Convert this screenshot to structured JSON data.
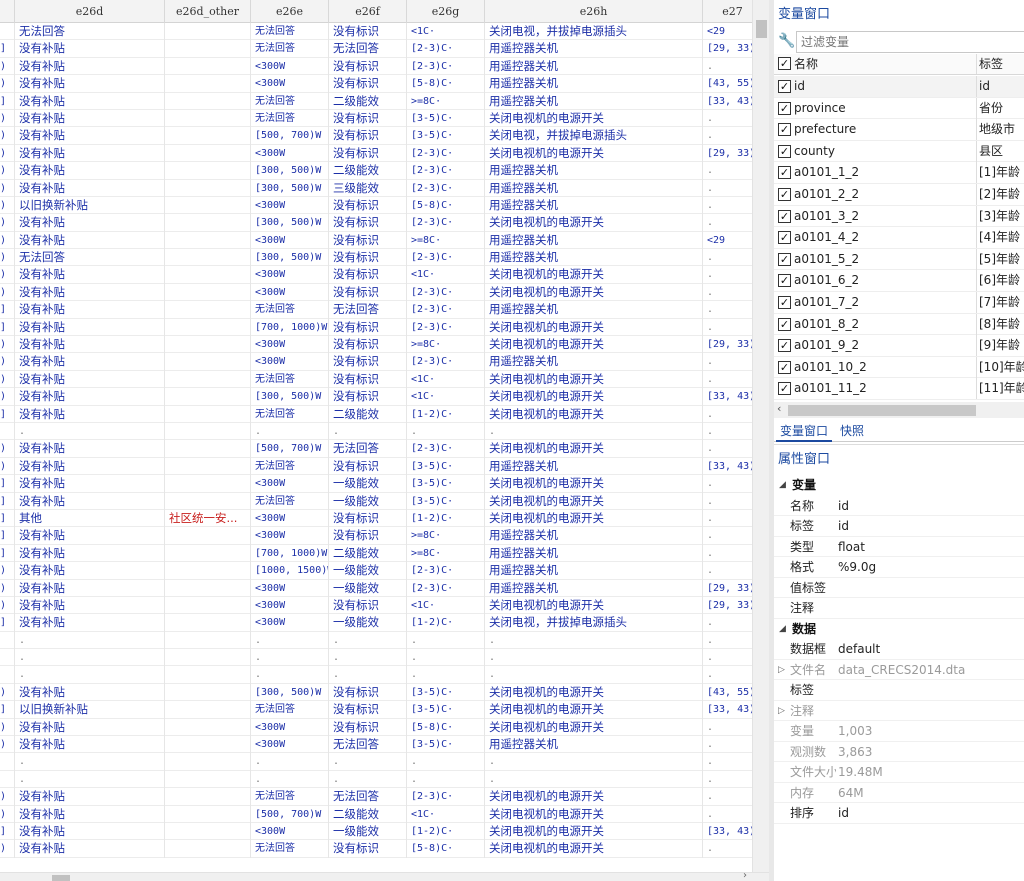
{
  "grid": {
    "columns": [
      "",
      "e26d",
      "e26d_other",
      "e26e",
      "e26f",
      "e26g",
      "e26h",
      "e27"
    ],
    "rows": [
      [
        "",
        "无法回答",
        "",
        "无法回答",
        "没有标识",
        "<1C·",
        "关闭电视，并拔掉电源插头",
        "<29"
      ],
      [
        "]",
        "没有补贴",
        "",
        "无法回答",
        "无法回答",
        "[2-3)C·",
        "用遥控器关机",
        "[29, 33)"
      ],
      [
        ")",
        "没有补贴",
        "",
        "<300W",
        "没有标识",
        "[2-3)C·",
        "用遥控器关机",
        "."
      ],
      [
        ")",
        "没有补贴",
        "",
        "<300W",
        "没有标识",
        "[5-8)C·",
        "用遥控器关机",
        "[43, 55)"
      ],
      [
        "]",
        "没有补贴",
        "",
        "无法回答",
        "二级能效",
        ">=8C·",
        "用遥控器关机",
        "[33, 43)"
      ],
      [
        ")",
        "没有补贴",
        "",
        "无法回答",
        "没有标识",
        "[3-5)C·",
        "关闭电视机的电源开关",
        "."
      ],
      [
        ")",
        "没有补贴",
        "",
        "[500, 700)W",
        "没有标识",
        "[3-5)C·",
        "关闭电视，并拔掉电源插头",
        "."
      ],
      [
        ")",
        "没有补贴",
        "",
        "<300W",
        "没有标识",
        "[2-3)C·",
        "关闭电视机的电源开关",
        "[29, 33)"
      ],
      [
        ")",
        "没有补贴",
        "",
        "[300, 500)W",
        "二级能效",
        "[2-3)C·",
        "用遥控器关机",
        "."
      ],
      [
        ")",
        "没有补贴",
        "",
        "[300, 500)W",
        "三级能效",
        "[2-3)C·",
        "用遥控器关机",
        "."
      ],
      [
        ")",
        "以旧换新补贴",
        "",
        "<300W",
        "没有标识",
        "[5-8)C·",
        "用遥控器关机",
        "."
      ],
      [
        ")",
        "没有补贴",
        "",
        "[300, 500)W",
        "没有标识",
        "[2-3)C·",
        "关闭电视机的电源开关",
        "."
      ],
      [
        ")",
        "没有补贴",
        "",
        "<300W",
        "没有标识",
        ">=8C·",
        "用遥控器关机",
        "<29"
      ],
      [
        ")",
        "无法回答",
        "",
        "[300, 500)W",
        "没有标识",
        "[2-3)C·",
        "用遥控器关机",
        "."
      ],
      [
        ")",
        "没有补贴",
        "",
        "<300W",
        "没有标识",
        "<1C·",
        "关闭电视机的电源开关",
        "."
      ],
      [
        ")",
        "没有补贴",
        "",
        "<300W",
        "没有标识",
        "[2-3)C·",
        "关闭电视机的电源开关",
        "."
      ],
      [
        "]",
        "没有补贴",
        "",
        "无法回答",
        "无法回答",
        "[2-3)C·",
        "用遥控器关机",
        "."
      ],
      [
        "]",
        "没有补贴",
        "",
        "[700, 1000)W",
        "没有标识",
        "[2-3)C·",
        "关闭电视机的电源开关",
        "."
      ],
      [
        ")",
        "没有补贴",
        "",
        "<300W",
        "没有标识",
        ">=8C·",
        "关闭电视机的电源开关",
        "[29, 33)"
      ],
      [
        ")",
        "没有补贴",
        "",
        "<300W",
        "没有标识",
        "[2-3)C·",
        "用遥控器关机",
        "."
      ],
      [
        ")",
        "没有补贴",
        "",
        "无法回答",
        "没有标识",
        "<1C·",
        "关闭电视机的电源开关",
        "."
      ],
      [
        ")",
        "没有补贴",
        "",
        "[300, 500)W",
        "没有标识",
        "<1C·",
        "关闭电视机的电源开关",
        "[33, 43)"
      ],
      [
        "]",
        "没有补贴",
        "",
        "无法回答",
        "二级能效",
        "[1-2)C·",
        "关闭电视机的电源开关",
        "."
      ],
      [
        "",
        ".",
        "",
        ".",
        ".",
        ".",
        ".",
        "."
      ],
      [
        ")",
        "没有补贴",
        "",
        "[500, 700)W",
        "无法回答",
        "[2-3)C·",
        "关闭电视机的电源开关",
        "."
      ],
      [
        ")",
        "没有补贴",
        "",
        "无法回答",
        "没有标识",
        "[3-5)C·",
        "用遥控器关机",
        "[33, 43)"
      ],
      [
        "]",
        "没有补贴",
        "",
        "<300W",
        "一级能效",
        "[3-5)C·",
        "关闭电视机的电源开关",
        "."
      ],
      [
        "]",
        "没有补贴",
        "",
        "无法回答",
        "一级能效",
        "[3-5)C·",
        "关闭电视机的电源开关",
        "."
      ],
      [
        "]",
        "其他",
        "社区统一安...",
        "<300W",
        "没有标识",
        "[1-2)C·",
        "关闭电视机的电源开关",
        "."
      ],
      [
        "]",
        "没有补贴",
        "",
        "<300W",
        "没有标识",
        ">=8C·",
        "用遥控器关机",
        "."
      ],
      [
        "]",
        "没有补贴",
        "",
        "[700, 1000)W",
        "二级能效",
        ">=8C·",
        "用遥控器关机",
        "."
      ],
      [
        ")",
        "没有补贴",
        "",
        "[1000, 1500)W",
        "一级能效",
        "[2-3)C·",
        "用遥控器关机",
        "."
      ],
      [
        ")",
        "没有补贴",
        "",
        "<300W",
        "一级能效",
        "[2-3)C·",
        "用遥控器关机",
        "[29, 33)"
      ],
      [
        ")",
        "没有补贴",
        "",
        "<300W",
        "没有标识",
        "<1C·",
        "关闭电视机的电源开关",
        "[29, 33)"
      ],
      [
        "]",
        "没有补贴",
        "",
        "<300W",
        "一级能效",
        "[1-2)C·",
        "关闭电视，并拔掉电源插头",
        "."
      ],
      [
        "",
        ".",
        "",
        ".",
        ".",
        ".",
        ".",
        "."
      ],
      [
        "",
        ".",
        "",
        ".",
        ".",
        ".",
        ".",
        "."
      ],
      [
        "",
        ".",
        "",
        ".",
        ".",
        ".",
        ".",
        "."
      ],
      [
        ")",
        "没有补贴",
        "",
        "[300, 500)W",
        "没有标识",
        "[3-5)C·",
        "关闭电视机的电源开关",
        "[43, 55)"
      ],
      [
        "]",
        "以旧换新补贴",
        "",
        "无法回答",
        "没有标识",
        "[3-5)C·",
        "关闭电视机的电源开关",
        "[33, 43)"
      ],
      [
        ")",
        "没有补贴",
        "",
        "<300W",
        "没有标识",
        "[5-8)C·",
        "关闭电视机的电源开关",
        "."
      ],
      [
        ")",
        "没有补贴",
        "",
        "<300W",
        "无法回答",
        "[3-5)C·",
        "用遥控器关机",
        "."
      ],
      [
        "",
        ".",
        "",
        ".",
        ".",
        ".",
        ".",
        "."
      ],
      [
        "",
        ".",
        "",
        ".",
        ".",
        ".",
        ".",
        "."
      ],
      [
        ")",
        "没有补贴",
        "",
        "无法回答",
        "无法回答",
        "[2-3)C·",
        "关闭电视机的电源开关",
        "."
      ],
      [
        ")",
        "没有补贴",
        "",
        "[500, 700)W",
        "二级能效",
        "<1C·",
        "关闭电视机的电源开关",
        "."
      ],
      [
        "]",
        "没有补贴",
        "",
        "<300W",
        "一级能效",
        "[1-2)C·",
        "关闭电视机的电源开关",
        "[33, 43)"
      ],
      [
        ")",
        "没有补贴",
        "",
        "无法回答",
        "没有标识",
        "[5-8)C·",
        "关闭电视机的电源开关",
        "."
      ]
    ]
  },
  "variables": {
    "title": "变量窗口",
    "filter_placeholder": "过滤变量",
    "col_name": "名称",
    "col_label": "标签",
    "items": [
      {
        "name": "id",
        "label": "id"
      },
      {
        "name": "province",
        "label": "省份"
      },
      {
        "name": "prefecture",
        "label": "地级市"
      },
      {
        "name": "county",
        "label": "县区"
      },
      {
        "name": "a0101_1_2",
        "label": "[1]年龄"
      },
      {
        "name": "a0101_2_2",
        "label": "[2]年龄"
      },
      {
        "name": "a0101_3_2",
        "label": "[3]年龄"
      },
      {
        "name": "a0101_4_2",
        "label": "[4]年龄"
      },
      {
        "name": "a0101_5_2",
        "label": "[5]年龄"
      },
      {
        "name": "a0101_6_2",
        "label": "[6]年龄"
      },
      {
        "name": "a0101_7_2",
        "label": "[7]年龄"
      },
      {
        "name": "a0101_8_2",
        "label": "[8]年龄"
      },
      {
        "name": "a0101_9_2",
        "label": "[9]年龄"
      },
      {
        "name": "a0101_10_2",
        "label": "[10]年龄"
      },
      {
        "name": "a0101_11_2",
        "label": "[11]年龄"
      }
    ],
    "tabs": [
      "变量窗口",
      "快照"
    ]
  },
  "properties": {
    "title": "属性窗口",
    "section_variable": "变量",
    "section_data": "数据",
    "var_rows": [
      {
        "key": "名称",
        "value": "id"
      },
      {
        "key": "标签",
        "value": "id"
      },
      {
        "key": "类型",
        "value": "float"
      },
      {
        "key": "格式",
        "value": "%9.0g"
      },
      {
        "key": "值标签",
        "value": ""
      },
      {
        "key": "注释",
        "value": ""
      }
    ],
    "data_rows": [
      {
        "key": "数据框",
        "value": "default",
        "dim": false,
        "tri": false
      },
      {
        "key": "文件名",
        "value": "data_CRECS2014.dta",
        "dim": true,
        "tri": true
      },
      {
        "key": "标签",
        "value": "",
        "dim": false,
        "tri": false
      },
      {
        "key": "注释",
        "value": "",
        "dim": true,
        "tri": true
      },
      {
        "key": "变量",
        "value": "1,003",
        "dim": true,
        "tri": false
      },
      {
        "key": "观测数",
        "value": "3,863",
        "dim": true,
        "tri": false
      },
      {
        "key": "文件大小",
        "value": "19.48M",
        "dim": true,
        "tri": false
      },
      {
        "key": "内存",
        "value": "64M",
        "dim": true,
        "tri": false
      },
      {
        "key": "排序",
        "value": "id",
        "dim": false,
        "tri": false
      }
    ]
  }
}
